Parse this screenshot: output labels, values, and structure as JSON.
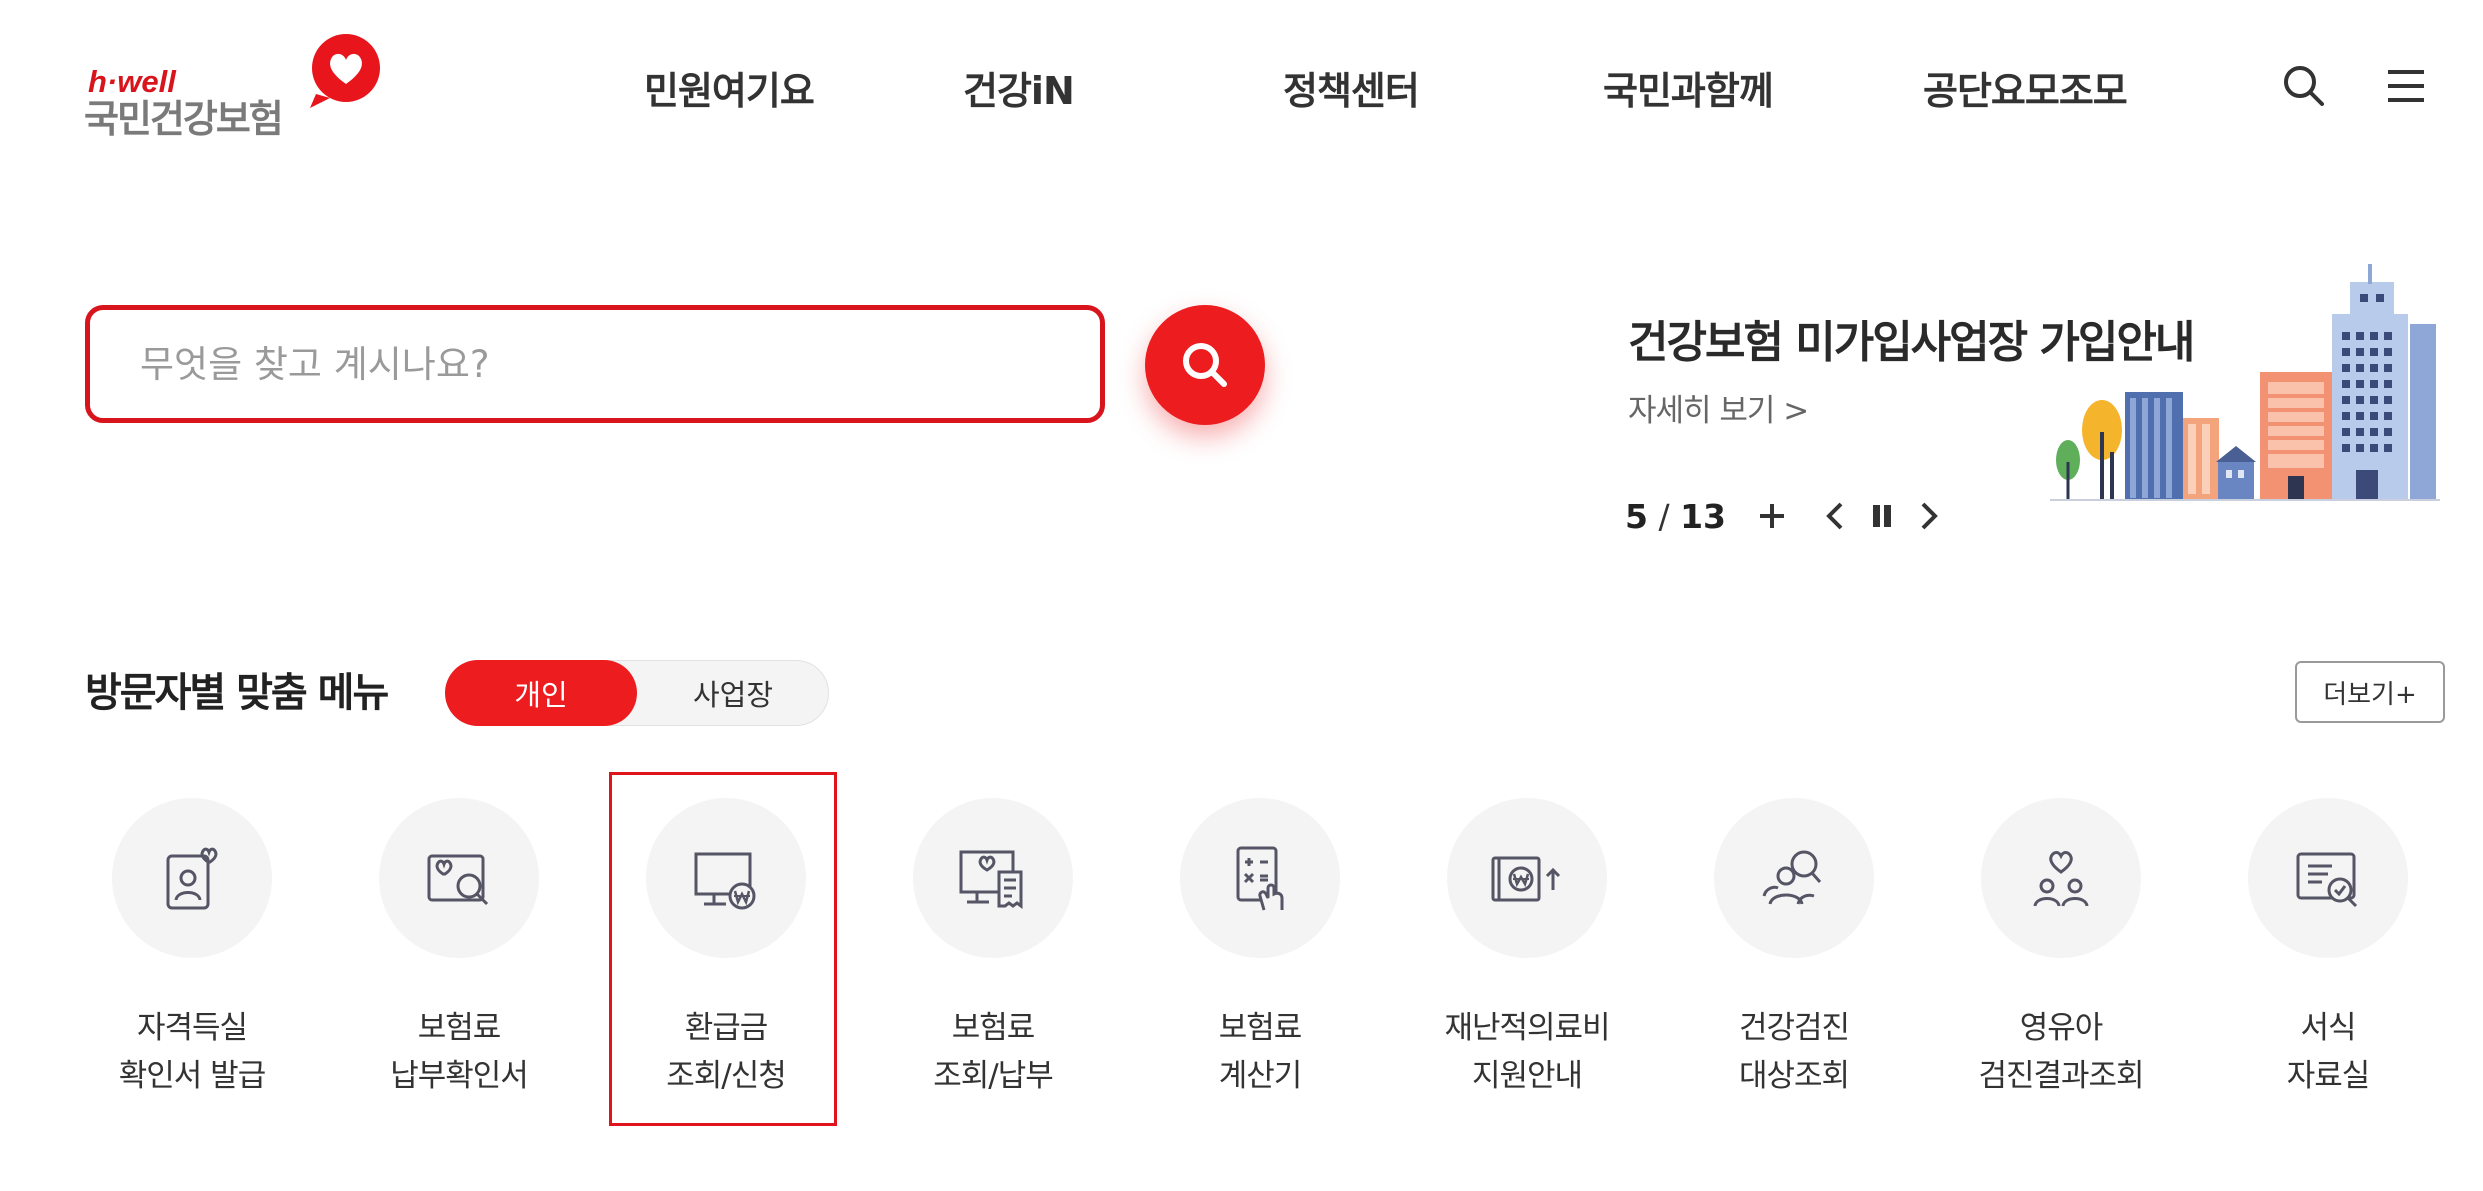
{
  "header": {
    "logo_brand": "h·well",
    "logo_name": "국민건강보험",
    "nav": [
      "민원여기요",
      "건강iN",
      "정책센터",
      "국민과함께",
      "공단요모조모"
    ],
    "icons": [
      "search-icon",
      "menu-icon"
    ]
  },
  "search": {
    "placeholder": "무엇을 찾고 계시나요?",
    "value": ""
  },
  "banner": {
    "title": "건강보험 미가입사업장 가입안내",
    "link": "자세히 보기 >",
    "current": "5",
    "separator": "/",
    "total": "13"
  },
  "section": {
    "title": "방문자별 맞춤 메뉴",
    "toggle": [
      "개인",
      "사업장"
    ],
    "active_toggle": "개인",
    "more": "더보기+"
  },
  "quick_menu": [
    {
      "line1": "자격득실",
      "line2": "확인서 발급",
      "icon": "id-card-heart-icon"
    },
    {
      "line1": "보험료",
      "line2": "납부확인서",
      "icon": "search-document-icon"
    },
    {
      "line1": "환급금",
      "line2": "조회/신청",
      "icon": "monitor-won-icon",
      "highlighted": true
    },
    {
      "line1": "보험료",
      "line2": "조회/납부",
      "icon": "monitor-receipt-icon"
    },
    {
      "line1": "보험료",
      "line2": "계산기",
      "icon": "calculator-icon"
    },
    {
      "line1": "재난적의료비",
      "line2": "지원안내",
      "icon": "wallet-won-icon"
    },
    {
      "line1": "건강검진",
      "line2": "대상조회",
      "icon": "people-search-icon"
    },
    {
      "line1": "영유아",
      "line2": "검진결과조회",
      "icon": "family-heart-icon"
    },
    {
      "line1": "서식",
      "line2": "자료실",
      "icon": "form-check-icon"
    }
  ],
  "colors": {
    "accent": "#ec1c1f",
    "text": "#333333",
    "icon_bg": "#f4f4f4",
    "icon_stroke": "#555566"
  }
}
